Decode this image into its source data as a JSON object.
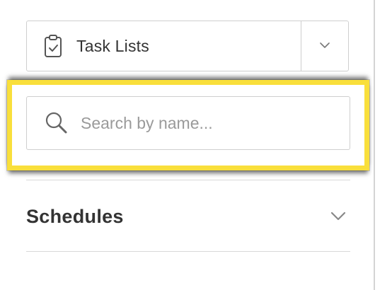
{
  "task_selector": {
    "label": "Task Lists",
    "icon": "clipboard-check-icon",
    "toggle_icon": "chevron-down-icon"
  },
  "search": {
    "placeholder": "Search by name...",
    "value": "",
    "icon": "search-icon",
    "highlight_color": "#f9df3b"
  },
  "schedules": {
    "title": "Schedules",
    "icon": "chevron-down-icon"
  }
}
